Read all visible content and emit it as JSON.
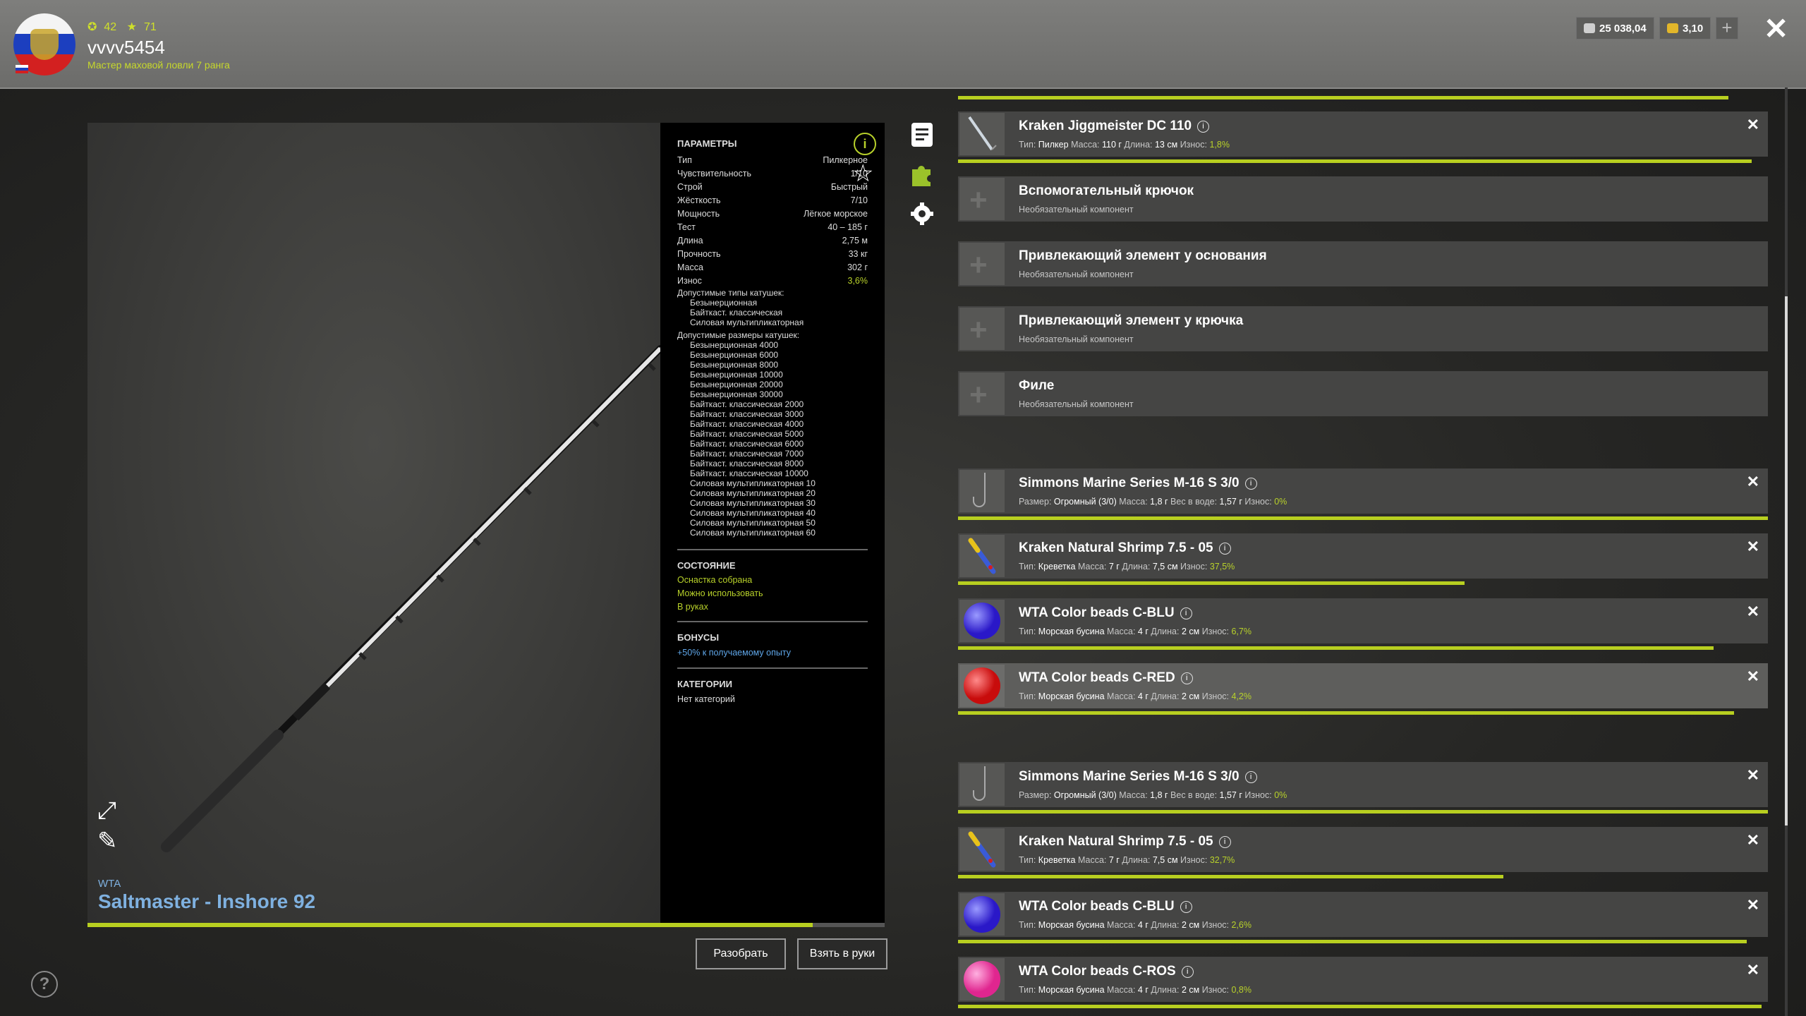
{
  "header": {
    "level": "42",
    "stars": "71",
    "username": "vvvv5454",
    "rank": "Мастер маховой ловли 7 ранга",
    "silver": "25 038,04",
    "gold": "3,10"
  },
  "rod": {
    "brand": "WTA",
    "name": "Saltmaster - Inshore 92",
    "condition": 0.91
  },
  "params": {
    "title": "ПАРАМЕТРЫ",
    "rows": [
      {
        "k": "Тип",
        "v": "Пилкерное"
      },
      {
        "k": "Чувствительность",
        "v": "1/10"
      },
      {
        "k": "Строй",
        "v": "Быстрый"
      },
      {
        "k": "Жёсткость",
        "v": "7/10"
      },
      {
        "k": "Мощность",
        "v": "Лёгкое морское"
      },
      {
        "k": "Тест",
        "v": "40 – 185 г"
      },
      {
        "k": "Длина",
        "v": "2,75 м"
      },
      {
        "k": "Прочность",
        "v": "33 кг"
      },
      {
        "k": "Масса",
        "v": "302 г"
      },
      {
        "k": "Износ",
        "v": "3,6%"
      }
    ],
    "reel_types_title": "Допустимые типы катушек:",
    "reel_types": [
      "Безынерционная",
      "Байткаст. классическая",
      "Силовая мультипликаторная"
    ],
    "reel_sizes_title": "Допустимые размеры катушек:",
    "reel_sizes": [
      "Безынерционная 4000",
      "Безынерционная 6000",
      "Безынерционная 8000",
      "Безынерционная 10000",
      "Безынерционная 20000",
      "Безынерционная 30000",
      "Байткаст. классическая 2000",
      "Байткаст. классическая 3000",
      "Байткаст. классическая 4000",
      "Байткаст. классическая 5000",
      "Байткаст. классическая 6000",
      "Байткаст. классическая 7000",
      "Байткаст. классическая 8000",
      "Байткаст. классическая 10000",
      "Силовая мультипликаторная 10",
      "Силовая мультипликаторная 20",
      "Силовая мультипликаторная 30",
      "Силовая мультипликаторная 40",
      "Силовая мультипликаторная 50",
      "Силовая мультипликаторная 60"
    ],
    "state_title": "СОСТОЯНИЕ",
    "state": [
      "Оснастка собрана",
      "Можно использовать",
      "В руках"
    ],
    "bonus_title": "БОНУСЫ",
    "bonus": "+50% к получаемому опыту",
    "cat_title": "КАТЕГОРИИ",
    "cat": "Нет категорий"
  },
  "buttons": {
    "disassemble": "Разобрать",
    "take": "Взять в руки"
  },
  "components": [
    {
      "title": "Kraken Jiggmeister DC 110",
      "info": true,
      "thumb": "jig",
      "sub": [
        [
          "Тип: ",
          "Пилкер"
        ],
        [
          "Масса: ",
          "110 г"
        ],
        [
          "Длина: ",
          "13 см"
        ]
      ],
      "wear": "1,8%",
      "wear_frac": 0.98,
      "close": true
    },
    {
      "title": "Вспомогательный крючок",
      "info": false,
      "thumb": "plus",
      "sub_text": "Необязательный компонент"
    },
    {
      "title": "Привлекающий элемент у основания",
      "info": false,
      "thumb": "plus",
      "sub_text": "Необязательный компонент"
    },
    {
      "title": "Привлекающий элемент у крючка",
      "info": false,
      "thumb": "plus",
      "sub_text": "Необязательный компонент"
    },
    {
      "title": "Филе",
      "info": false,
      "thumb": "plus",
      "sub_text": "Необязательный компонент"
    },
    {
      "title": "Simmons Marine Series M-16 S 3/0",
      "info": true,
      "thumb": "hook",
      "sub": [
        [
          "Размер: ",
          "Огромный (3/0)"
        ],
        [
          "Масса: ",
          "1,8 г"
        ],
        [
          "Вес в воде: ",
          "1,57 г"
        ]
      ],
      "wear": "0%",
      "wear_frac": 1.0,
      "close": true
    },
    {
      "title": "Kraken Natural Shrimp 7.5 - 05",
      "info": true,
      "thumb": "shrimp",
      "sub": [
        [
          "Тип: ",
          "Креветка"
        ],
        [
          "Масса: ",
          "7 г"
        ],
        [
          "Длина: ",
          "7,5 см"
        ]
      ],
      "wear": "37,5%",
      "wear_frac": 0.625,
      "close": true
    },
    {
      "title": "WTA Color beads C-BLU",
      "info": true,
      "thumb": "bead-blue",
      "sub": [
        [
          "Тип: ",
          "Морская бусина"
        ],
        [
          "Масса: ",
          "4 г"
        ],
        [
          "Длина: ",
          "2 см"
        ]
      ],
      "wear": "6,7%",
      "wear_frac": 0.933,
      "close": true
    },
    {
      "title": "WTA Color beads C-RED",
      "info": true,
      "thumb": "bead-red",
      "selected": true,
      "sub": [
        [
          "Тип: ",
          "Морская бусина"
        ],
        [
          "Масса: ",
          "4 г"
        ],
        [
          "Длина: ",
          "2 см"
        ]
      ],
      "wear": "4,2%",
      "wear_frac": 0.958,
      "close": true
    },
    {
      "title": "Simmons Marine Series M-16 S 3/0",
      "info": true,
      "thumb": "hook",
      "sub": [
        [
          "Размер: ",
          "Огромный (3/0)"
        ],
        [
          "Масса: ",
          "1,8 г"
        ],
        [
          "Вес в воде: ",
          "1,57 г"
        ]
      ],
      "wear": "0%",
      "wear_frac": 1.0,
      "close": true
    },
    {
      "title": "Kraken Natural Shrimp 7.5 - 05",
      "info": true,
      "thumb": "shrimp",
      "sub": [
        [
          "Тип: ",
          "Креветка"
        ],
        [
          "Масса: ",
          "7 г"
        ],
        [
          "Длина: ",
          "7,5 см"
        ]
      ],
      "wear": "32,7%",
      "wear_frac": 0.673,
      "close": true
    },
    {
      "title": "WTA Color beads C-BLU",
      "info": true,
      "thumb": "bead-blue",
      "sub": [
        [
          "Тип: ",
          "Морская бусина"
        ],
        [
          "Масса: ",
          "4 г"
        ],
        [
          "Длина: ",
          "2 см"
        ]
      ],
      "wear": "2,6%",
      "wear_frac": 0.974,
      "close": true
    },
    {
      "title": "WTA Color beads C-ROS",
      "info": true,
      "thumb": "bead-pink",
      "sub": [
        [
          "Тип: ",
          "Морская бусина"
        ],
        [
          "Масса: ",
          "4 г"
        ],
        [
          "Длина: ",
          "2 см"
        ]
      ],
      "wear": "0,8%",
      "wear_frac": 0.992,
      "close": true
    }
  ],
  "wear_label": "Износ: ",
  "icons": {
    "info": "i",
    "close": "✕",
    "help": "?",
    "star": "☆"
  }
}
